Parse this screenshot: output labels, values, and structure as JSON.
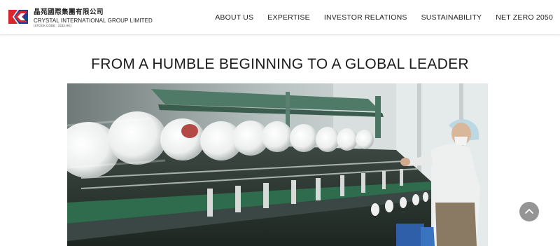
{
  "brand": {
    "name_cn": "晶苑國際集團有限公司",
    "name_en": "CRYSTAL INTERNATIONAL GROUP LIMITED",
    "stock_code": "(STOCK CODE : 2232.HK)",
    "logo_colors": {
      "red": "#d7262e",
      "blue": "#1d3f93"
    }
  },
  "nav": {
    "items": [
      {
        "label": "ABOUT US"
      },
      {
        "label": "EXPERTISE"
      },
      {
        "label": "INVESTOR RELATIONS"
      },
      {
        "label": "SUSTAINABILITY"
      },
      {
        "label": "NET ZERO 2050"
      }
    ]
  },
  "main": {
    "title": "FROM A HUMBLE BEGINNING TO A GLOBAL LEADER",
    "hero_image": "textile-factory-spinning-machine"
  },
  "scroll_top": {
    "icon": "chevron-up-icon"
  }
}
